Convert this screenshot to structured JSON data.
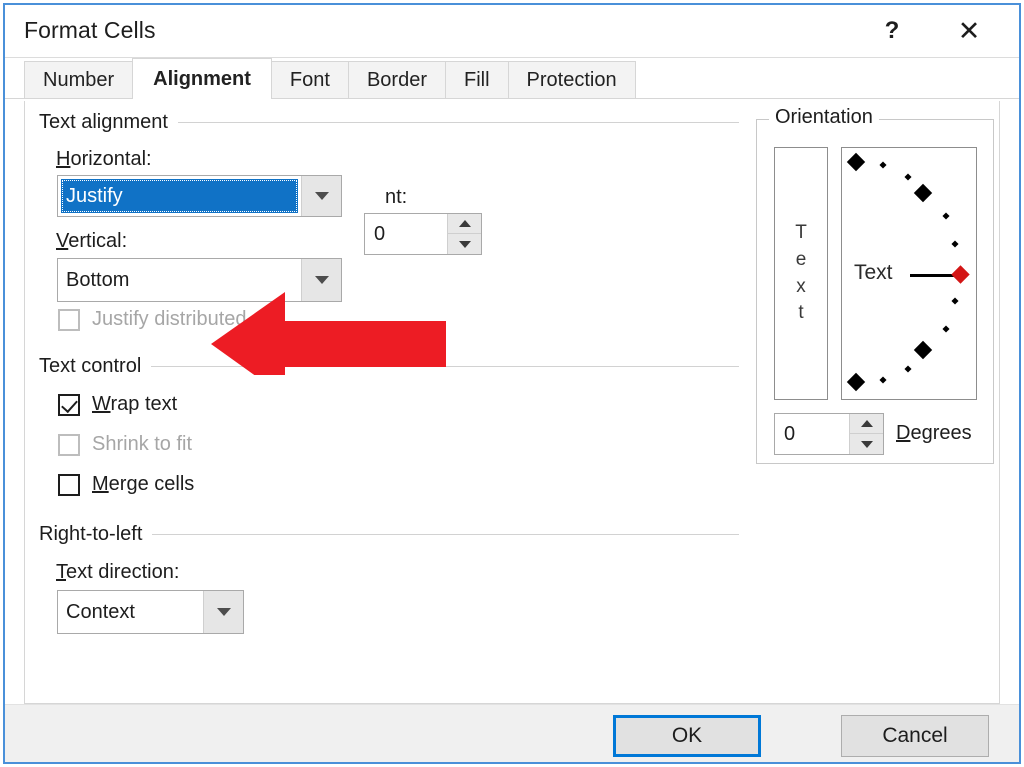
{
  "window": {
    "title": "Format Cells",
    "help_icon": "?",
    "close_icon": "✕"
  },
  "tabs": [
    {
      "label": "Number",
      "active": false
    },
    {
      "label": "Alignment",
      "active": true
    },
    {
      "label": "Font",
      "active": false
    },
    {
      "label": "Border",
      "active": false
    },
    {
      "label": "Fill",
      "active": false
    },
    {
      "label": "Protection",
      "active": false
    }
  ],
  "text_alignment": {
    "group_label": "Text alignment",
    "horizontal_label": "Horizontal:",
    "horizontal_value": "Justify",
    "indent_label": "Indent:",
    "indent_label_visible": "nt:",
    "indent_value": "0",
    "vertical_label": "Vertical:",
    "vertical_value": "Bottom",
    "justify_distributed_label": "Justify distributed",
    "justify_distributed_checked": false,
    "justify_distributed_enabled": false
  },
  "text_control": {
    "group_label": "Text control",
    "items": [
      {
        "label": "Wrap text",
        "checked": true,
        "enabled": true
      },
      {
        "label": "Shrink to fit",
        "checked": false,
        "enabled": false
      },
      {
        "label": "Merge cells",
        "checked": false,
        "enabled": true
      }
    ]
  },
  "right_to_left": {
    "group_label": "Right-to-left",
    "text_direction_label": "Text direction:",
    "text_direction_value": "Context"
  },
  "orientation": {
    "group_label": "Orientation",
    "vertical_text_letters": [
      "T",
      "e",
      "x",
      "t"
    ],
    "dial_label": "Text",
    "degrees_value": "0",
    "degrees_label": "Degrees",
    "marker_angle_degrees": 0
  },
  "footer": {
    "ok_label": "OK",
    "cancel_label": "Cancel"
  },
  "annotation": {
    "arrow_color": "#ed1c24",
    "arrow_direction": "left",
    "points_to": "horizontal-alignment-combobox"
  },
  "colors": {
    "accent": "#0078d7",
    "selection": "#1072c6",
    "window_border": "#4a90d9",
    "arrow_red": "#ed1c24",
    "dial_marker_red": "#d31616"
  }
}
